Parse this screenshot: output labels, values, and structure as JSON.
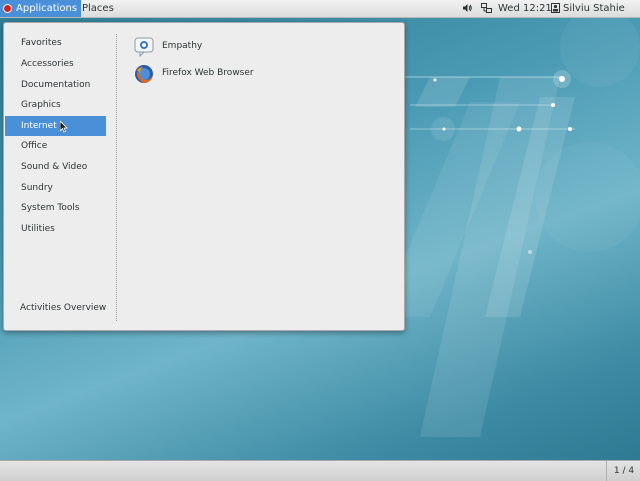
{
  "top_bar": {
    "applications_label": "Applications",
    "places_label": "Places",
    "clock": "Wed 12:21",
    "user_name": "Silviu Stahie",
    "icons": [
      "fedora-logo-icon",
      "volume-icon",
      "network-icon",
      "user-icon"
    ]
  },
  "app_menu": {
    "categories": [
      {
        "label": "Favorites"
      },
      {
        "label": "Accessories"
      },
      {
        "label": "Documentation"
      },
      {
        "label": "Graphics"
      },
      {
        "label": "Internet",
        "selected": true
      },
      {
        "label": "Office"
      },
      {
        "label": "Sound & Video"
      },
      {
        "label": "Sundry"
      },
      {
        "label": "System Tools"
      },
      {
        "label": "Utilities"
      }
    ],
    "activities_overview": "Activities Overview",
    "apps": [
      {
        "label": "Empathy",
        "icon": "empathy-icon"
      },
      {
        "label": "Firefox Web Browser",
        "icon": "firefox-icon"
      }
    ]
  },
  "bottom_bar": {
    "workspace": "1 / 4"
  },
  "colors": {
    "selection": "#4a90d9",
    "desktop": "#3f8fa8"
  }
}
